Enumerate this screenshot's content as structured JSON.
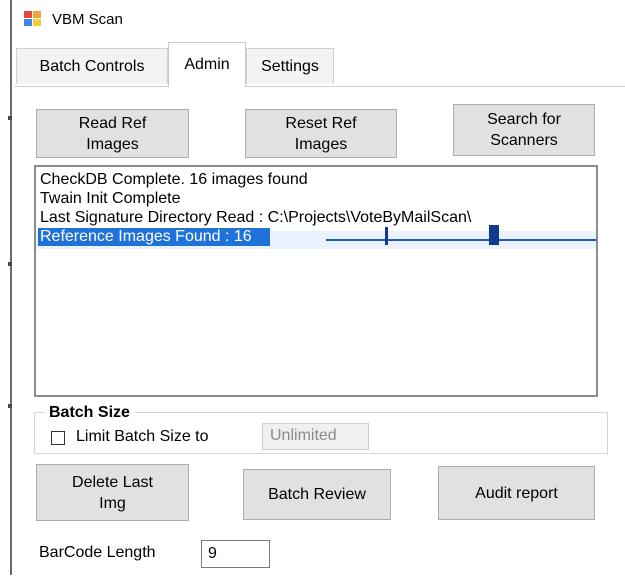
{
  "window": {
    "title": "VBM Scan"
  },
  "tabs": [
    {
      "label": "Batch Controls"
    },
    {
      "label": "Admin"
    },
    {
      "label": "Settings"
    }
  ],
  "buttons": {
    "read_ref": "Read Ref\nImages",
    "reset_ref": "Reset Ref\nImages",
    "search": "Search for\nScanners",
    "delete_last": "Delete Last\nImg",
    "batch_review": "Batch Review",
    "audit_report": "Audit report"
  },
  "log": {
    "lines": [
      "CheckDB Complete. 16 images found",
      "Twain Init Complete",
      "Last Signature Directory Read : C:\\Projects\\VoteByMailScan\\"
    ],
    "selected_line": "Reference Images Found : 16"
  },
  "batch_size": {
    "title": "Batch Size",
    "checkbox_label": "Limit Batch Size to",
    "checked": false,
    "value": "Unlimited"
  },
  "barcode": {
    "label": "BarCode Length",
    "value": "9"
  },
  "colors": {
    "selection": "#1e72d8",
    "button_face": "#e1e1e1"
  }
}
